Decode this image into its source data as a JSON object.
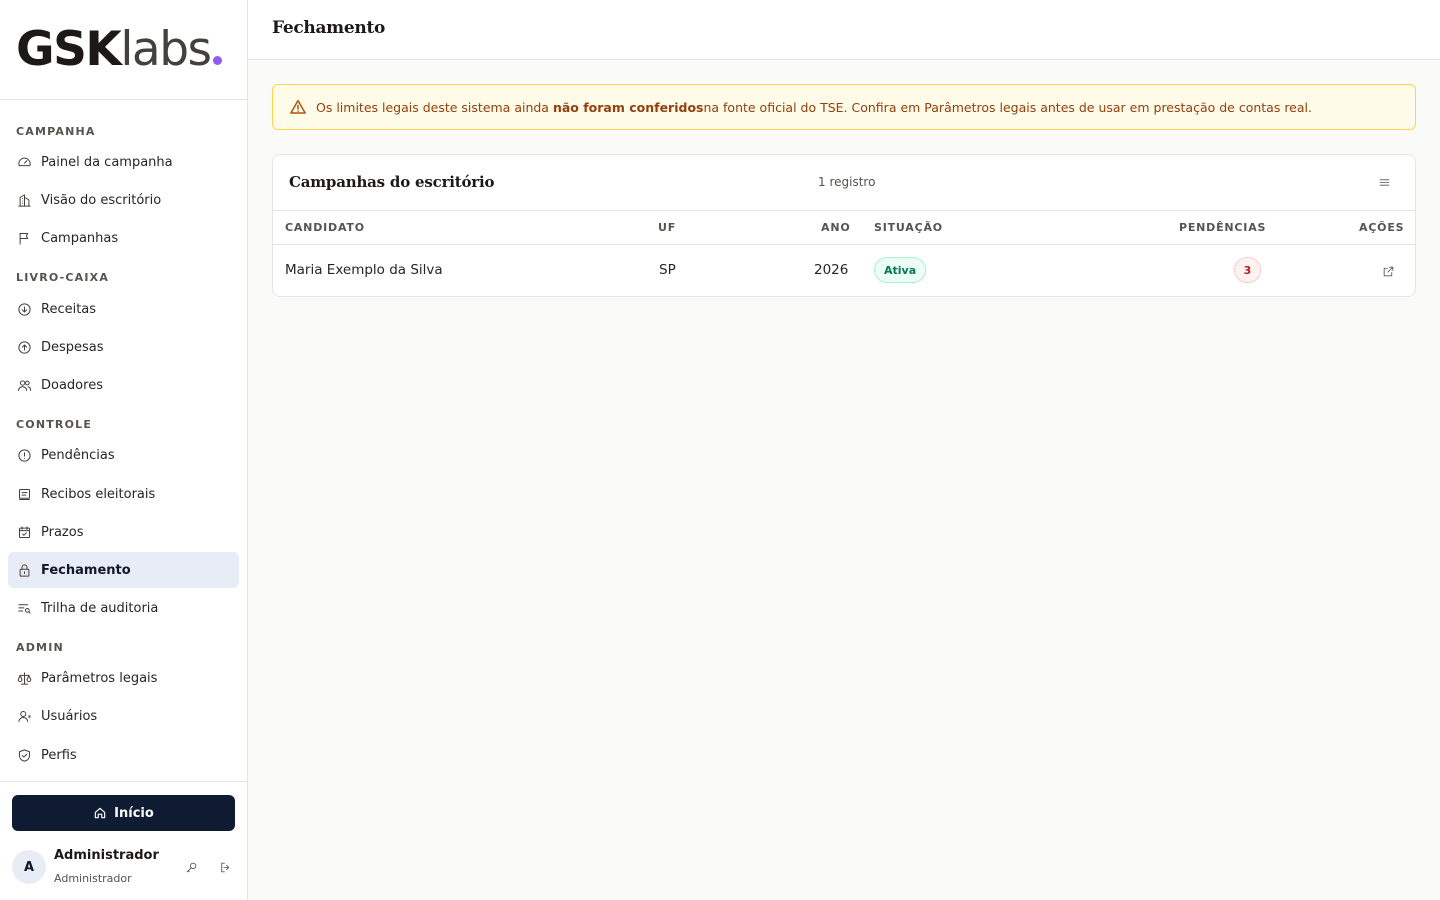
{
  "brand": {
    "part1": "GSK",
    "part2": "labs"
  },
  "sidebar": {
    "sections": [
      {
        "title": "CAMPANHA",
        "items": [
          {
            "label": "Painel da campanha",
            "icon": "gauge-icon"
          },
          {
            "label": "Visão do escritório",
            "icon": "building-icon"
          },
          {
            "label": "Campanhas",
            "icon": "flag-icon"
          }
        ]
      },
      {
        "title": "LIVRO-CAIXA",
        "items": [
          {
            "label": "Receitas",
            "icon": "arrow-down-circle-icon"
          },
          {
            "label": "Despesas",
            "icon": "arrow-up-circle-icon"
          },
          {
            "label": "Doadores",
            "icon": "users-icon"
          }
        ]
      },
      {
        "title": "CONTROLE",
        "items": [
          {
            "label": "Pendências",
            "icon": "alert-circle-icon"
          },
          {
            "label": "Recibos eleitorais",
            "icon": "receipt-icon"
          },
          {
            "label": "Prazos",
            "icon": "calendar-check-icon"
          },
          {
            "label": "Fechamento",
            "icon": "lock-icon",
            "active": true
          },
          {
            "label": "Trilha de auditoria",
            "icon": "list-search-icon"
          }
        ]
      },
      {
        "title": "ADMIN",
        "items": [
          {
            "label": "Parâmetros legais",
            "icon": "scale-icon"
          },
          {
            "label": "Usuários",
            "icon": "user-icon"
          },
          {
            "label": "Perfis",
            "icon": "shield-icon"
          }
        ]
      }
    ],
    "home_button": "Início",
    "user": {
      "initial": "A",
      "name": "Administrador",
      "role": "Administrador"
    }
  },
  "header": {
    "title": "Fechamento"
  },
  "alert": {
    "pre": "Os limites legais deste sistema ainda ",
    "bold": "não foram conferidos",
    "post": " na fonte oficial do TSE. Confira em Parâmetros legais antes de usar em prestação de contas real."
  },
  "table": {
    "title": "Campanhas do escritório",
    "count": "1 registro",
    "columns": [
      "CANDIDATO",
      "UF",
      "ANO",
      "SITUAÇÃO",
      "PENDÊNCIAS",
      "AÇÕES"
    ],
    "rows": [
      {
        "candidato": "Maria Exemplo da Silva",
        "uf": "SP",
        "ano": "2026",
        "situacao": "Ativa",
        "pendencias": "3"
      }
    ]
  },
  "colors": {
    "accent_dot": "#8b5cf6",
    "primary": "#0f1b33",
    "active_bg": "#e8ecf6",
    "warning": "#92400e",
    "success": "#047857",
    "danger": "#b91c1c"
  }
}
